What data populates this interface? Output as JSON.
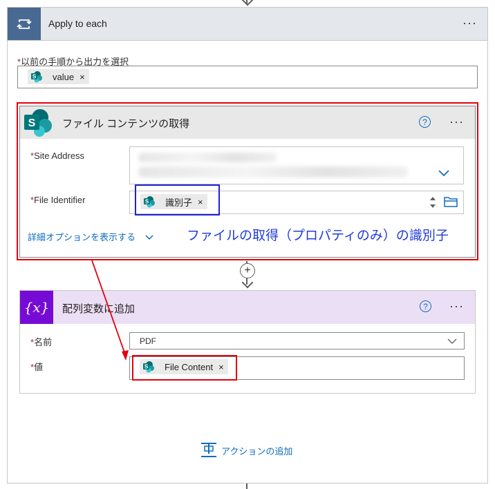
{
  "apply_each": {
    "title": "Apply to each",
    "more": "···",
    "select_output": {
      "label": "以前の手順から出力を選択",
      "required_mark": "*",
      "token": "value",
      "token_remove": "×"
    }
  },
  "get_file_content": {
    "title": "ファイル コンテンツの取得",
    "help": "?",
    "more": "···",
    "site_address": {
      "label": "Site Address",
      "required_mark": "*"
    },
    "file_identifier": {
      "label": "File Identifier",
      "required_mark": "*",
      "token": "識別子",
      "token_remove": "×"
    },
    "advanced_link": "詳細オプションを表示する"
  },
  "annotation": "ファイルの取得（プロパティのみ）の識別子",
  "add_step": "+",
  "append_variable": {
    "title": "配列変数に追加",
    "icon_text": "{x}",
    "help": "?",
    "more": "···",
    "name": {
      "label": "名前",
      "required_mark": "*",
      "value": "PDF"
    },
    "value": {
      "label": "値",
      "required_mark": "*",
      "token": "File Content",
      "token_remove": "×"
    }
  },
  "add_action": "アクションの追加",
  "colors": {
    "loop_header": "#486991",
    "variable_header": "#770bd6",
    "sharepoint": "#036c70",
    "highlight_red": "#e3000f",
    "highlight_blue": "#1f1fd6",
    "link": "#0f6cbd"
  }
}
